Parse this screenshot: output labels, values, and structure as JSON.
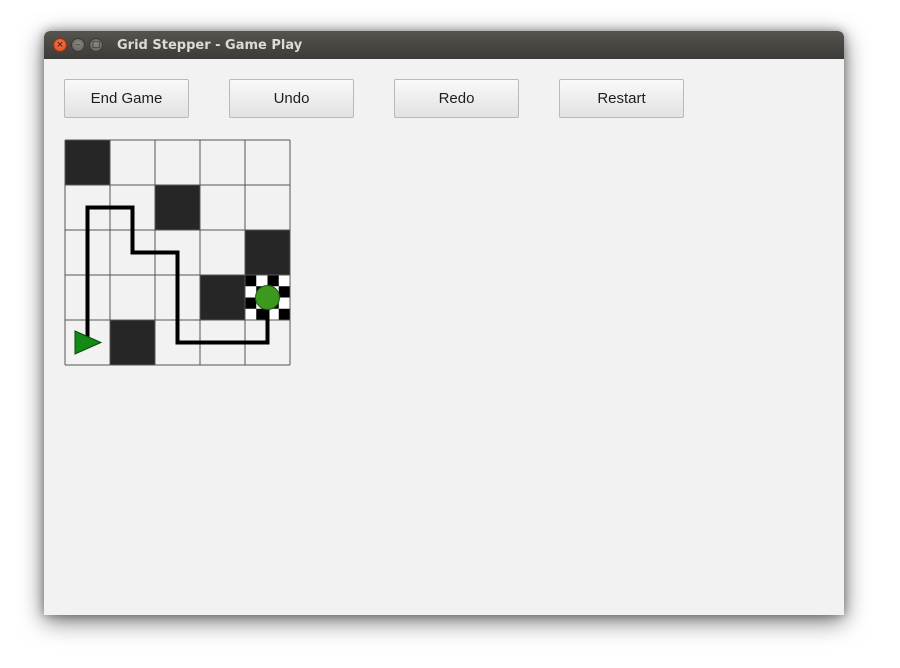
{
  "window": {
    "title": "Grid Stepper - Game Play",
    "controls": [
      "close",
      "minimize",
      "maximize"
    ]
  },
  "toolbar": {
    "end_game_label": "End Game",
    "undo_label": "Undo",
    "redo_label": "Redo",
    "restart_label": "Restart"
  },
  "board": {
    "rows": 5,
    "cols": 5,
    "colors": {
      "empty": "#f2f2f2",
      "wall": "#262626",
      "grid_line": "#555555",
      "path": "#000000",
      "start_marker": "#138a13",
      "player": "#3b9a1e"
    },
    "walls": [
      [
        0,
        0
      ],
      [
        1,
        2
      ],
      [
        2,
        4
      ],
      [
        3,
        3
      ],
      [
        4,
        1
      ]
    ],
    "start": {
      "row": 4,
      "col": 0,
      "icon": "play-triangle-icon"
    },
    "goal": {
      "row": 3,
      "col": 4,
      "icon": "checkered-flag-icon"
    },
    "player": {
      "row": 3,
      "col": 4
    },
    "path": [
      {
        "row": 4.0,
        "col": 0.0
      },
      {
        "row": 1.0,
        "col": 0.0
      },
      {
        "row": 1.0,
        "col": 1.0
      },
      {
        "row": 2.0,
        "col": 1.0
      },
      {
        "row": 2.0,
        "col": 2.0
      },
      {
        "row": 4.0,
        "col": 2.0
      },
      {
        "row": 4.0,
        "col": 4.0
      },
      {
        "row": 3.0,
        "col": 4.0
      }
    ]
  }
}
